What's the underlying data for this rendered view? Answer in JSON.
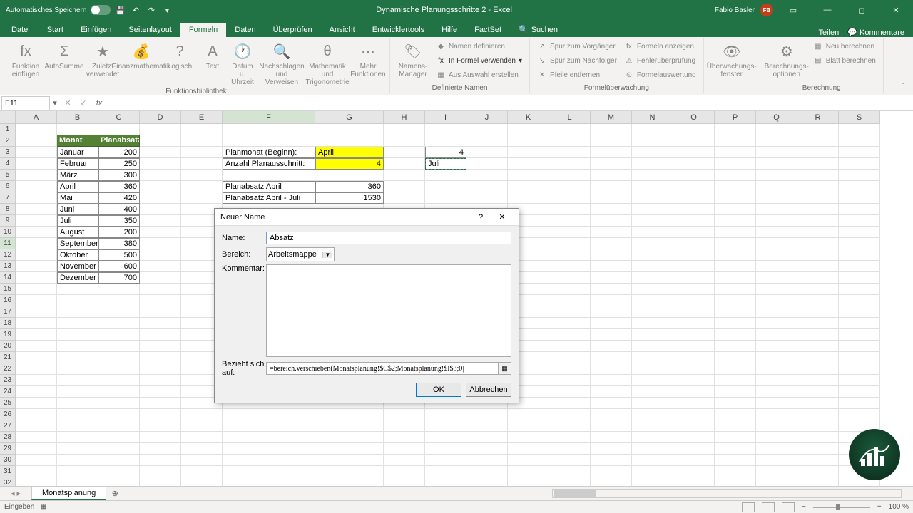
{
  "app": {
    "autosave_label": "Automatisches Speichern",
    "title": "Dynamische Planungsschritte 2 - Excel",
    "user_name": "Fabio Basler",
    "user_initials": "FB"
  },
  "tabs": {
    "file": "Datei",
    "start": "Start",
    "insert": "Einfügen",
    "layout": "Seitenlayout",
    "formulas": "Formeln",
    "data": "Daten",
    "review": "Überprüfen",
    "view": "Ansicht",
    "dev": "Entwicklertools",
    "help": "Hilfe",
    "factset": "FactSet",
    "search": "Suchen",
    "share": "Teilen",
    "comments": "Kommentare"
  },
  "ribbon": {
    "g1": {
      "insert_fn": "Funktion einfügen",
      "autosum": "AutoSumme",
      "recent": "Zuletzt verwendet",
      "financial": "Finanzmathematik",
      "logical": "Logisch",
      "text": "Text",
      "datetime": "Datum u. Uhrzeit",
      "lookup": "Nachschlagen und Verweisen",
      "math": "Mathematik und Trigonometrie",
      "more": "Mehr Funktionen",
      "label": "Funktionsbibliothek"
    },
    "g2": {
      "name_mgr": "Namens-Manager",
      "define": "Namen definieren",
      "use": "In Formel verwenden",
      "create": "Aus Auswahl erstellen",
      "label": "Definierte Namen"
    },
    "g3": {
      "trace_prec": "Spur zum Vorgänger",
      "trace_dep": "Spur zum Nachfolger",
      "remove": "Pfeile entfernen",
      "show_f": "Formeln anzeigen",
      "err_chk": "Fehlerüberprüfung",
      "eval": "Formelauswertung",
      "label": "Formelüberwachung"
    },
    "g4": {
      "watch": "Überwachungs-fenster"
    },
    "g5": {
      "calc_opt": "Berechnungs-optionen",
      "calc_now": "Neu berechnen",
      "calc_sheet": "Blatt berechnen",
      "label": "Berechnung"
    }
  },
  "formula_bar": {
    "name_box": "F11"
  },
  "columns": [
    "A",
    "B",
    "C",
    "D",
    "E",
    "F",
    "G",
    "H",
    "I",
    "J",
    "K",
    "L",
    "M",
    "N",
    "O",
    "P",
    "Q",
    "R",
    "S"
  ],
  "table": {
    "h1": "Monat",
    "h2": "Planabsatz",
    "rows": [
      {
        "m": "Januar",
        "v": "200"
      },
      {
        "m": "Februar",
        "v": "250"
      },
      {
        "m": "März",
        "v": "300"
      },
      {
        "m": "April",
        "v": "360"
      },
      {
        "m": "Mai",
        "v": "420"
      },
      {
        "m": "Juni",
        "v": "400"
      },
      {
        "m": "Juli",
        "v": "350"
      },
      {
        "m": "August",
        "v": "200"
      },
      {
        "m": "September",
        "v": "380"
      },
      {
        "m": "Oktober",
        "v": "500"
      },
      {
        "m": "November",
        "v": "600"
      },
      {
        "m": "Dezember",
        "v": "700"
      }
    ]
  },
  "panel": {
    "planmonat_lbl": "Planmonat (Beginn):",
    "planmonat_val": "April",
    "anzahl_lbl": "Anzahl Planausschnitt:",
    "anzahl_val": "4",
    "i3": "4",
    "i4": "Juli",
    "abs1_lbl": "Planabsatz April",
    "abs1_val": "360",
    "abs2_lbl": "Planabsatz April - Juli",
    "abs2_val": "1530"
  },
  "dialog": {
    "title": "Neuer Name",
    "name_lbl": "Name:",
    "name_val": "Absatz",
    "scope_lbl": "Bereich:",
    "scope_val": "Arbeitsmappe",
    "comment_lbl": "Kommentar:",
    "ref_lbl": "Bezieht sich auf:",
    "ref_val": "=bereich.verschieben(Monatsplanung!$C$2;Monatsplanung!$I$3;0|",
    "ok": "OK",
    "cancel": "Abbrechen",
    "help": "?"
  },
  "sheet": {
    "name": "Monatsplanung"
  },
  "status": {
    "mode": "Eingeben",
    "zoom": "100 %"
  }
}
